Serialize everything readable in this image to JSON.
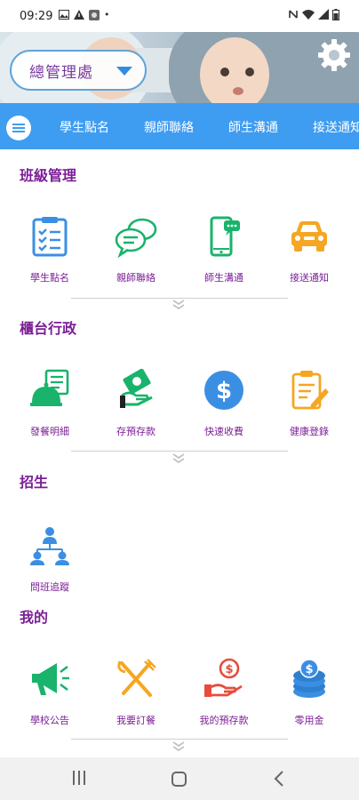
{
  "status_bar": {
    "time": "09:29",
    "left_icons": [
      "image-icon",
      "warning-icon",
      "app-icon",
      "dot"
    ],
    "right_icons": [
      "nfc-icon",
      "wifi-icon",
      "signal-icon",
      "battery-icon"
    ],
    "dot": "•"
  },
  "header": {
    "org_select_value": "總管理處",
    "settings_icon": "gear-icon"
  },
  "nav": {
    "tabs": [
      "學生點名",
      "親師聯絡",
      "師生溝通",
      "接送通知"
    ]
  },
  "sections": [
    {
      "title": "班級管理",
      "items": [
        "學生點名",
        "親師聯絡",
        "師生溝通",
        "接送通知"
      ]
    },
    {
      "title": "櫃台行政",
      "items": [
        "發餐明細",
        "存預存款",
        "快速收費",
        "健康登錄"
      ]
    },
    {
      "title": "招生",
      "items": [
        "問班追蹤"
      ]
    },
    {
      "title": "我的",
      "items": [
        "學校公告",
        "我要訂餐",
        "我的預存款",
        "零用金"
      ]
    }
  ],
  "colors": {
    "accent": "#3e9cf1",
    "title": "#7b1f96",
    "blue": "#3b8fe3",
    "green": "#19b36b",
    "orange": "#f5a623",
    "red": "#e74c3c"
  }
}
